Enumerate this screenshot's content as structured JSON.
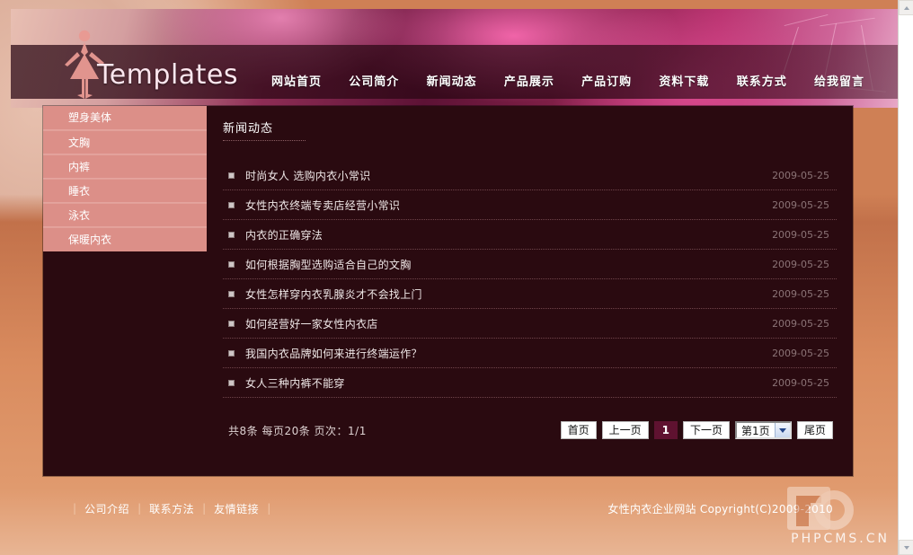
{
  "site": {
    "logo_text": "Templates",
    "nav": [
      {
        "label": "网站首页"
      },
      {
        "label": "公司简介"
      },
      {
        "label": "新闻动态"
      },
      {
        "label": "产品展示"
      },
      {
        "label": "产品订购"
      },
      {
        "label": "资料下载"
      },
      {
        "label": "联系方式"
      },
      {
        "label": "给我留言"
      }
    ]
  },
  "sidebar": {
    "items": [
      {
        "label": "塑身美体"
      },
      {
        "label": "文胸"
      },
      {
        "label": "内裤"
      },
      {
        "label": "睡衣"
      },
      {
        "label": "泳衣"
      },
      {
        "label": "保暖内衣"
      }
    ]
  },
  "content": {
    "section_title": "新闻动态",
    "news": [
      {
        "title": "时尚女人 选购内衣小常识",
        "date": "2009-05-25"
      },
      {
        "title": "女性内衣终端专卖店经营小常识",
        "date": "2009-05-25"
      },
      {
        "title": "内衣的正确穿法",
        "date": "2009-05-25"
      },
      {
        "title": "如何根据胸型选购适合自己的文胸",
        "date": "2009-05-25"
      },
      {
        "title": "女性怎样穿内衣乳腺炎才不会找上门",
        "date": "2009-05-25"
      },
      {
        "title": "如何经营好一家女性内衣店",
        "date": "2009-05-25"
      },
      {
        "title": "我国内衣品牌如何来进行终端运作？",
        "date": "2009-05-25"
      },
      {
        "title": "女人三种内裤不能穿",
        "date": "2009-05-25"
      }
    ]
  },
  "pager": {
    "stat": "共8条 每页20条 页次：1/1",
    "first": "首页",
    "prev": "上一页",
    "current_page": "1",
    "next": "下一页",
    "page_select_value": "第1页",
    "last": "尾页"
  },
  "footer": {
    "links": [
      {
        "label": "公司介绍"
      },
      {
        "label": "联系方法"
      },
      {
        "label": "友情链接"
      }
    ],
    "separator": "|",
    "copyright": "女性内衣企业网站  Copyright(C)2009-2010"
  },
  "watermark": {
    "text": "PHPCMS.CN"
  },
  "colors": {
    "sidebar_bg": "#dc8f88",
    "content_bg": "#2a0a10",
    "banner_accent": "#b8336f",
    "pager_current_bg": "#5f1230"
  }
}
